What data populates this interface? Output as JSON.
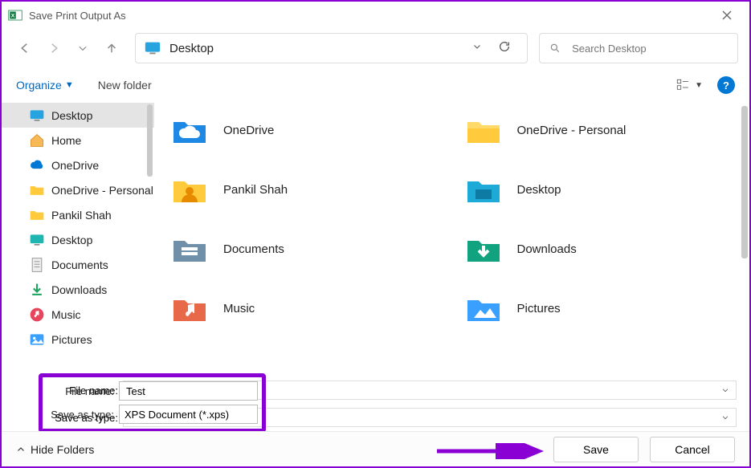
{
  "title": "Save Print Output As",
  "address": {
    "location": "Desktop"
  },
  "search": {
    "placeholder": "Search Desktop"
  },
  "toolbar": {
    "organize": "Organize",
    "new_folder": "New folder"
  },
  "sidebar": {
    "items": [
      {
        "label": "Desktop",
        "icon": "desktop-blue",
        "selected": true
      },
      {
        "label": "Home",
        "icon": "home"
      },
      {
        "label": "OneDrive",
        "icon": "cloud"
      },
      {
        "label": "OneDrive - Personal",
        "icon": "folder-y"
      },
      {
        "label": "Pankil Shah",
        "icon": "folder-y"
      },
      {
        "label": "Desktop",
        "icon": "desktop-teal"
      },
      {
        "label": "Documents",
        "icon": "doc"
      },
      {
        "label": "Downloads",
        "icon": "download"
      },
      {
        "label": "Music",
        "icon": "music"
      },
      {
        "label": "Pictures",
        "icon": "pictures"
      }
    ]
  },
  "grid": {
    "items": [
      {
        "label": "OneDrive",
        "icon": "onedrive-folder"
      },
      {
        "label": "OneDrive - Personal",
        "icon": "folder-y-big"
      },
      {
        "label": "Pankil Shah",
        "icon": "user-folder"
      },
      {
        "label": "Desktop",
        "icon": "desktop-folder"
      },
      {
        "label": "Documents",
        "icon": "docs-folder"
      },
      {
        "label": "Downloads",
        "icon": "downloads-folder"
      },
      {
        "label": "Music",
        "icon": "music-folder"
      },
      {
        "label": "Pictures",
        "icon": "pictures-folder"
      }
    ]
  },
  "fields": {
    "name_label": "File name:",
    "name_value": "Test",
    "type_label": "Save as type:",
    "type_value": "XPS Document (*.xps)"
  },
  "footer": {
    "hide_folders": "Hide Folders",
    "save": "Save",
    "cancel": "Cancel"
  }
}
